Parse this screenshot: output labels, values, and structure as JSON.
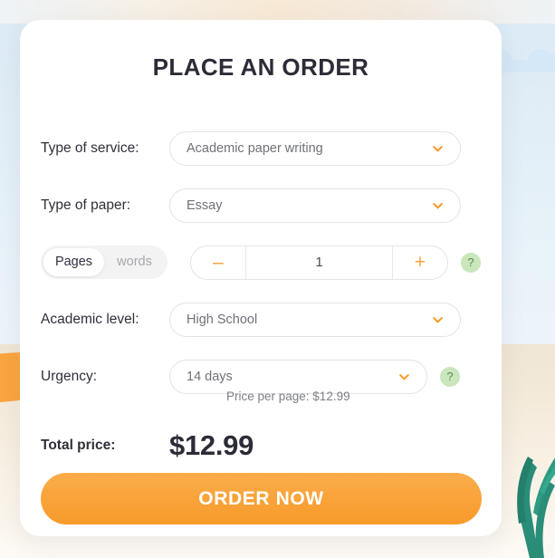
{
  "card": {
    "title": "PLACE AN ORDER"
  },
  "form": {
    "service": {
      "label": "Type of service:",
      "value": "Academic paper writing"
    },
    "paper": {
      "label": "Type of paper:",
      "value": "Essay"
    },
    "amount": {
      "toggle_pages": "Pages",
      "toggle_words": "words",
      "active_toggle": "Pages",
      "minus": "–",
      "plus": "+",
      "value": "1",
      "help": "?"
    },
    "level": {
      "label": "Academic level:",
      "value": "High School"
    },
    "urgency": {
      "label": "Urgency:",
      "value": "14 days",
      "help": "?",
      "price_per_page": "Price per page: $12.99"
    }
  },
  "total": {
    "label": "Total price:",
    "value": "$12.99"
  },
  "cta": {
    "label": "ORDER NOW"
  },
  "colors": {
    "accent_orange": "#f79a2a",
    "help_green_bg": "#c9e6bd",
    "help_green_fg": "#5e8a52",
    "cloud_blue": "#d5e8f7",
    "grass_green": "#2a8d78",
    "text_dark": "#2c2c38"
  }
}
